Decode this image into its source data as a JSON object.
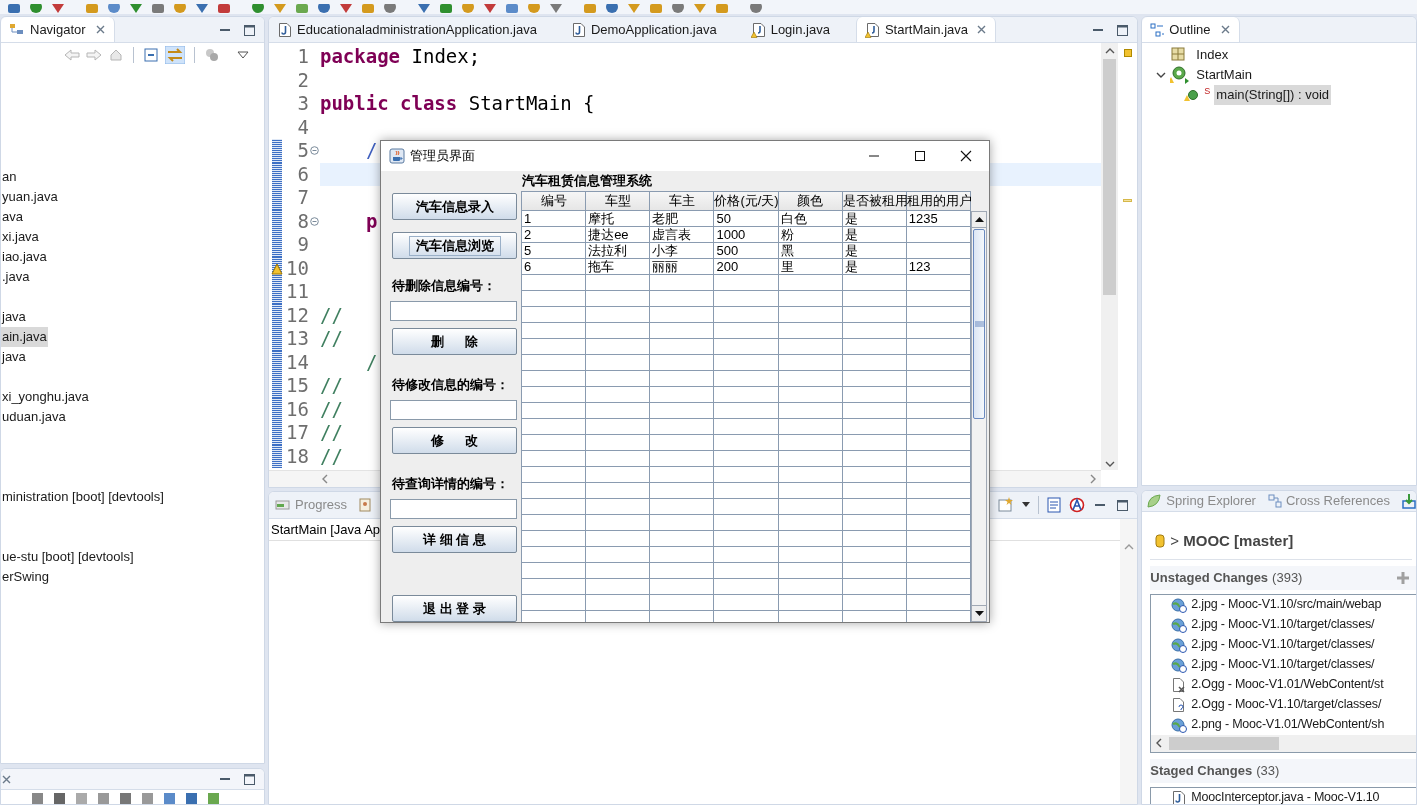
{
  "navigator": {
    "tab": "Navigator",
    "items": [
      {
        "kind": "blank"
      },
      {
        "kind": "blank"
      },
      {
        "kind": "blank"
      },
      {
        "kind": "blank"
      },
      {
        "kind": "blank"
      },
      {
        "kind": "item",
        "text": "an",
        "selected": false
      },
      {
        "kind": "item",
        "text": "yuan.java",
        "selected": false
      },
      {
        "kind": "item",
        "text": "ava",
        "selected": false
      },
      {
        "kind": "item",
        "text": "xi.java",
        "selected": false
      },
      {
        "kind": "item",
        "text": "iao.java",
        "selected": false
      },
      {
        "kind": "item",
        "text": ".java",
        "selected": false
      },
      {
        "kind": "blank"
      },
      {
        "kind": "item",
        "text": "java",
        "selected": false
      },
      {
        "kind": "item",
        "text": "ain.java",
        "selected": true
      },
      {
        "kind": "item",
        "text": "java",
        "selected": false
      },
      {
        "kind": "blank"
      },
      {
        "kind": "item",
        "text": "xi_yonghu.java",
        "selected": false
      },
      {
        "kind": "item",
        "text": "uduan.java",
        "selected": false
      },
      {
        "kind": "blank"
      },
      {
        "kind": "blank"
      },
      {
        "kind": "blank"
      },
      {
        "kind": "item",
        "text": "ministration [boot] [devtools]",
        "selected": false
      },
      {
        "kind": "blank"
      },
      {
        "kind": "blank"
      },
      {
        "kind": "item",
        "text": "ue-stu [boot] [devtools]",
        "selected": false
      },
      {
        "kind": "item",
        "text": "erSwing",
        "selected": false
      }
    ]
  },
  "editor": {
    "tabs": [
      {
        "label": "EducationaladministrationApplication.java",
        "selected": false,
        "warning": false
      },
      {
        "label": "DemoApplication.java",
        "selected": false,
        "warning": false
      },
      {
        "label": "Login.java",
        "selected": false,
        "warning": true
      },
      {
        "label": "StartMain.java",
        "selected": true,
        "warning": true
      }
    ],
    "lines": [
      {
        "number": "1",
        "current": false,
        "changed": false,
        "fold": false,
        "warning": false,
        "segments": [
          {
            "kind": "keyword",
            "text": "package"
          },
          {
            "kind": "plain",
            "text": " Index;"
          }
        ]
      },
      {
        "number": "2",
        "current": false,
        "changed": false,
        "fold": false,
        "warning": false
      },
      {
        "number": "3",
        "current": false,
        "changed": false,
        "fold": false,
        "warning": false,
        "segments": [
          {
            "kind": "keyword",
            "text": "public class"
          },
          {
            "kind": "plain",
            "text": " StartMain {"
          }
        ]
      },
      {
        "number": "4",
        "current": false,
        "changed": false,
        "fold": false,
        "warning": false
      },
      {
        "number": "5",
        "current": false,
        "changed": true,
        "fold": true,
        "warning": false,
        "indented": true,
        "segments": [
          {
            "kind": "javadoc",
            "text": "/"
          }
        ]
      },
      {
        "number": "6",
        "current": true,
        "changed": true,
        "fold": false,
        "warning": false
      },
      {
        "number": "7",
        "current": false,
        "changed": true,
        "fold": false,
        "warning": false
      },
      {
        "number": "8",
        "current": false,
        "changed": true,
        "fold": true,
        "warning": false,
        "indented": true,
        "segments": [
          {
            "kind": "keyword",
            "text": "p"
          }
        ]
      },
      {
        "number": "9",
        "current": false,
        "changed": true,
        "fold": false,
        "warning": false
      },
      {
        "number": "10",
        "current": false,
        "changed": true,
        "fold": false,
        "warning": true
      },
      {
        "number": "11",
        "current": false,
        "changed": true,
        "fold": false,
        "warning": false
      },
      {
        "number": "12",
        "current": false,
        "changed": true,
        "fold": false,
        "warning": false,
        "segments": [
          {
            "kind": "comment",
            "text": "//"
          }
        ]
      },
      {
        "number": "13",
        "current": false,
        "changed": true,
        "fold": false,
        "warning": false,
        "segments": [
          {
            "kind": "comment",
            "text": "//"
          }
        ]
      },
      {
        "number": "14",
        "current": false,
        "changed": true,
        "fold": false,
        "warning": false,
        "indented": true,
        "segments": [
          {
            "kind": "comment",
            "text": "/"
          }
        ]
      },
      {
        "number": "15",
        "current": false,
        "changed": true,
        "fold": false,
        "warning": false,
        "segments": [
          {
            "kind": "comment",
            "text": "//"
          }
        ]
      },
      {
        "number": "16",
        "current": false,
        "changed": true,
        "fold": false,
        "warning": false,
        "segments": [
          {
            "kind": "comment",
            "text": "//"
          }
        ]
      },
      {
        "number": "17",
        "current": false,
        "changed": true,
        "fold": false,
        "warning": false,
        "segments": [
          {
            "kind": "comment",
            "text": "//"
          }
        ]
      },
      {
        "number": "18",
        "current": false,
        "changed": true,
        "fold": false,
        "warning": false,
        "segments": [
          {
            "kind": "comment",
            "text": "//"
          }
        ]
      }
    ]
  },
  "console": {
    "tabs": [
      {
        "label": "Progress",
        "selected": false
      }
    ],
    "text": "StartMain [Java Ap"
  },
  "outline": {
    "tab": "Outline",
    "items": [
      {
        "kind": "package",
        "label": "Index",
        "selected": false
      },
      {
        "kind": "class",
        "label": "StartMain",
        "selected": false,
        "expanded": true,
        "children": [
          {
            "kind": "method",
            "modifier": "S",
            "label": "main(String[]) : void",
            "selected": true
          }
        ]
      }
    ]
  },
  "git": {
    "tabs": [
      {
        "label": "Spring Explorer",
        "selected": false
      },
      {
        "label": "Cross References",
        "selected": false
      }
    ],
    "repository": "> **MOOC [master]**",
    "unstaged": {
      "title": "Unstaged Changes",
      "count": "(393)",
      "files": [
        {
          "kind": "web",
          "label": "2.jpg - Mooc-V1.10/src/main/webap"
        },
        {
          "kind": "web",
          "label": "2.jpg - Mooc-V1.10/target/classes/"
        },
        {
          "kind": "web",
          "label": "2.jpg - Mooc-V1.10/target/classes/"
        },
        {
          "kind": "web",
          "label": "2.jpg - Mooc-V1.10/target/classes/"
        },
        {
          "kind": "missing",
          "label": "2.Ogg - Mooc-V1.01/WebContent/st"
        },
        {
          "kind": "untracked",
          "label": "2.Ogg - Mooc-V1.10/target/classes/"
        },
        {
          "kind": "web",
          "label": "2.png - Mooc-V1.01/WebContent/sh"
        }
      ]
    },
    "staged": {
      "title": "Staged Changes",
      "count": "(33)",
      "files": [
        {
          "kind": "java",
          "label": "MoocInterceptor.java - Mooc-V1.10"
        }
      ]
    }
  },
  "dialog": {
    "title": "管理员界面",
    "heading": "汽车租赁信息管理系统",
    "controls": [
      {
        "kind": "button",
        "label": "汽车信息录入",
        "focused": false
      },
      {
        "kind": "button",
        "label": "汽车信息浏览",
        "focused": true
      },
      {
        "kind": "label",
        "text": "待删除信息编号："
      },
      {
        "kind": "field"
      },
      {
        "kind": "button",
        "label": "删      除",
        "focused": false
      },
      {
        "kind": "label",
        "text": "待修改信息的编号："
      },
      {
        "kind": "field"
      },
      {
        "kind": "button",
        "label": "修      改",
        "focused": false
      },
      {
        "kind": "label",
        "text": "待查询详情的编号："
      },
      {
        "kind": "field"
      },
      {
        "kind": "button",
        "label": "详 细 信 息",
        "focused": false
      },
      {
        "kind": "button",
        "label": "退 出 登 录",
        "focused": false
      }
    ],
    "table": {
      "columns": [
        "编号",
        "车型",
        "车主",
        "价格(元/天)",
        "颜色",
        "是否被租用",
        "租用的用户"
      ],
      "rows": [
        [
          "1",
          "摩托",
          "老肥",
          "50",
          "白色",
          "是",
          "1235"
        ],
        [
          "2",
          "捷达ee",
          "虚言表",
          "1000",
          "粉",
          "是",
          null
        ],
        [
          "5",
          "法拉利",
          "小李",
          "500",
          "黑",
          "是",
          null
        ],
        [
          "6",
          "拖车",
          "丽丽",
          "200",
          "里",
          "是",
          "123"
        ]
      ]
    }
  }
}
